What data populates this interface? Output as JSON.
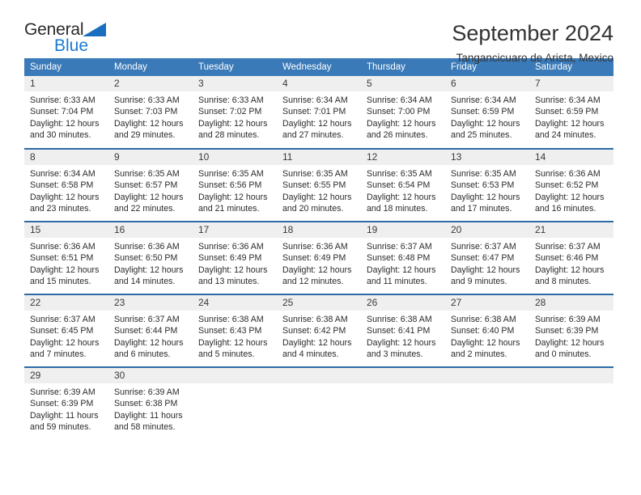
{
  "brand": {
    "name_primary": "General",
    "name_secondary": "Blue",
    "accent_color": "#1a7ad4",
    "triangle_color": "#1a6ec0"
  },
  "header": {
    "title": "September 2024",
    "subtitle": "Tangancicuaro de Arista, Mexico"
  },
  "theme": {
    "header_row_bg": "#3a7ab8",
    "daynum_bg": "#efefef",
    "week_divider": "#2e6aa8",
    "text": "#2b2b2b"
  },
  "weekday_headers": [
    "Sunday",
    "Monday",
    "Tuesday",
    "Wednesday",
    "Thursday",
    "Friday",
    "Saturday"
  ],
  "weeks": [
    [
      {
        "day": "1",
        "sunrise": "Sunrise: 6:33 AM",
        "sunset": "Sunset: 7:04 PM",
        "daylight_line1": "Daylight: 12 hours",
        "daylight_line2": "and 30 minutes."
      },
      {
        "day": "2",
        "sunrise": "Sunrise: 6:33 AM",
        "sunset": "Sunset: 7:03 PM",
        "daylight_line1": "Daylight: 12 hours",
        "daylight_line2": "and 29 minutes."
      },
      {
        "day": "3",
        "sunrise": "Sunrise: 6:33 AM",
        "sunset": "Sunset: 7:02 PM",
        "daylight_line1": "Daylight: 12 hours",
        "daylight_line2": "and 28 minutes."
      },
      {
        "day": "4",
        "sunrise": "Sunrise: 6:34 AM",
        "sunset": "Sunset: 7:01 PM",
        "daylight_line1": "Daylight: 12 hours",
        "daylight_line2": "and 27 minutes."
      },
      {
        "day": "5",
        "sunrise": "Sunrise: 6:34 AM",
        "sunset": "Sunset: 7:00 PM",
        "daylight_line1": "Daylight: 12 hours",
        "daylight_line2": "and 26 minutes."
      },
      {
        "day": "6",
        "sunrise": "Sunrise: 6:34 AM",
        "sunset": "Sunset: 6:59 PM",
        "daylight_line1": "Daylight: 12 hours",
        "daylight_line2": "and 25 minutes."
      },
      {
        "day": "7",
        "sunrise": "Sunrise: 6:34 AM",
        "sunset": "Sunset: 6:59 PM",
        "daylight_line1": "Daylight: 12 hours",
        "daylight_line2": "and 24 minutes."
      }
    ],
    [
      {
        "day": "8",
        "sunrise": "Sunrise: 6:34 AM",
        "sunset": "Sunset: 6:58 PM",
        "daylight_line1": "Daylight: 12 hours",
        "daylight_line2": "and 23 minutes."
      },
      {
        "day": "9",
        "sunrise": "Sunrise: 6:35 AM",
        "sunset": "Sunset: 6:57 PM",
        "daylight_line1": "Daylight: 12 hours",
        "daylight_line2": "and 22 minutes."
      },
      {
        "day": "10",
        "sunrise": "Sunrise: 6:35 AM",
        "sunset": "Sunset: 6:56 PM",
        "daylight_line1": "Daylight: 12 hours",
        "daylight_line2": "and 21 minutes."
      },
      {
        "day": "11",
        "sunrise": "Sunrise: 6:35 AM",
        "sunset": "Sunset: 6:55 PM",
        "daylight_line1": "Daylight: 12 hours",
        "daylight_line2": "and 20 minutes."
      },
      {
        "day": "12",
        "sunrise": "Sunrise: 6:35 AM",
        "sunset": "Sunset: 6:54 PM",
        "daylight_line1": "Daylight: 12 hours",
        "daylight_line2": "and 18 minutes."
      },
      {
        "day": "13",
        "sunrise": "Sunrise: 6:35 AM",
        "sunset": "Sunset: 6:53 PM",
        "daylight_line1": "Daylight: 12 hours",
        "daylight_line2": "and 17 minutes."
      },
      {
        "day": "14",
        "sunrise": "Sunrise: 6:36 AM",
        "sunset": "Sunset: 6:52 PM",
        "daylight_line1": "Daylight: 12 hours",
        "daylight_line2": "and 16 minutes."
      }
    ],
    [
      {
        "day": "15",
        "sunrise": "Sunrise: 6:36 AM",
        "sunset": "Sunset: 6:51 PM",
        "daylight_line1": "Daylight: 12 hours",
        "daylight_line2": "and 15 minutes."
      },
      {
        "day": "16",
        "sunrise": "Sunrise: 6:36 AM",
        "sunset": "Sunset: 6:50 PM",
        "daylight_line1": "Daylight: 12 hours",
        "daylight_line2": "and 14 minutes."
      },
      {
        "day": "17",
        "sunrise": "Sunrise: 6:36 AM",
        "sunset": "Sunset: 6:49 PM",
        "daylight_line1": "Daylight: 12 hours",
        "daylight_line2": "and 13 minutes."
      },
      {
        "day": "18",
        "sunrise": "Sunrise: 6:36 AM",
        "sunset": "Sunset: 6:49 PM",
        "daylight_line1": "Daylight: 12 hours",
        "daylight_line2": "and 12 minutes."
      },
      {
        "day": "19",
        "sunrise": "Sunrise: 6:37 AM",
        "sunset": "Sunset: 6:48 PM",
        "daylight_line1": "Daylight: 12 hours",
        "daylight_line2": "and 11 minutes."
      },
      {
        "day": "20",
        "sunrise": "Sunrise: 6:37 AM",
        "sunset": "Sunset: 6:47 PM",
        "daylight_line1": "Daylight: 12 hours",
        "daylight_line2": "and 9 minutes."
      },
      {
        "day": "21",
        "sunrise": "Sunrise: 6:37 AM",
        "sunset": "Sunset: 6:46 PM",
        "daylight_line1": "Daylight: 12 hours",
        "daylight_line2": "and 8 minutes."
      }
    ],
    [
      {
        "day": "22",
        "sunrise": "Sunrise: 6:37 AM",
        "sunset": "Sunset: 6:45 PM",
        "daylight_line1": "Daylight: 12 hours",
        "daylight_line2": "and 7 minutes."
      },
      {
        "day": "23",
        "sunrise": "Sunrise: 6:37 AM",
        "sunset": "Sunset: 6:44 PM",
        "daylight_line1": "Daylight: 12 hours",
        "daylight_line2": "and 6 minutes."
      },
      {
        "day": "24",
        "sunrise": "Sunrise: 6:38 AM",
        "sunset": "Sunset: 6:43 PM",
        "daylight_line1": "Daylight: 12 hours",
        "daylight_line2": "and 5 minutes."
      },
      {
        "day": "25",
        "sunrise": "Sunrise: 6:38 AM",
        "sunset": "Sunset: 6:42 PM",
        "daylight_line1": "Daylight: 12 hours",
        "daylight_line2": "and 4 minutes."
      },
      {
        "day": "26",
        "sunrise": "Sunrise: 6:38 AM",
        "sunset": "Sunset: 6:41 PM",
        "daylight_line1": "Daylight: 12 hours",
        "daylight_line2": "and 3 minutes."
      },
      {
        "day": "27",
        "sunrise": "Sunrise: 6:38 AM",
        "sunset": "Sunset: 6:40 PM",
        "daylight_line1": "Daylight: 12 hours",
        "daylight_line2": "and 2 minutes."
      },
      {
        "day": "28",
        "sunrise": "Sunrise: 6:39 AM",
        "sunset": "Sunset: 6:39 PM",
        "daylight_line1": "Daylight: 12 hours",
        "daylight_line2": "and 0 minutes."
      }
    ],
    [
      {
        "day": "29",
        "sunrise": "Sunrise: 6:39 AM",
        "sunset": "Sunset: 6:39 PM",
        "daylight_line1": "Daylight: 11 hours",
        "daylight_line2": "and 59 minutes."
      },
      {
        "day": "30",
        "sunrise": "Sunrise: 6:39 AM",
        "sunset": "Sunset: 6:38 PM",
        "daylight_line1": "Daylight: 11 hours",
        "daylight_line2": "and 58 minutes."
      },
      {
        "day": "",
        "sunrise": "",
        "sunset": "",
        "daylight_line1": "",
        "daylight_line2": ""
      },
      {
        "day": "",
        "sunrise": "",
        "sunset": "",
        "daylight_line1": "",
        "daylight_line2": ""
      },
      {
        "day": "",
        "sunrise": "",
        "sunset": "",
        "daylight_line1": "",
        "daylight_line2": ""
      },
      {
        "day": "",
        "sunrise": "",
        "sunset": "",
        "daylight_line1": "",
        "daylight_line2": ""
      },
      {
        "day": "",
        "sunrise": "",
        "sunset": "",
        "daylight_line1": "",
        "daylight_line2": ""
      }
    ]
  ]
}
